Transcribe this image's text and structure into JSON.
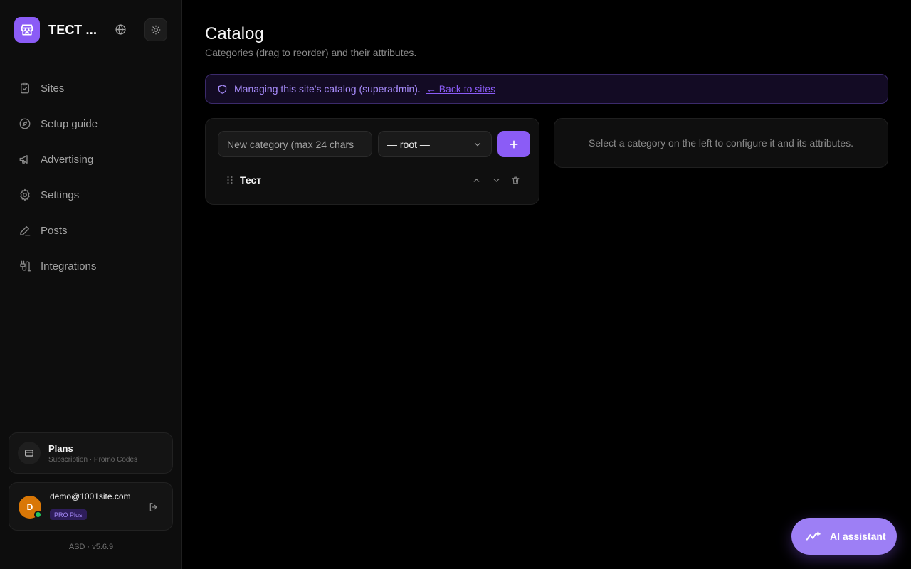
{
  "sidebar": {
    "site_name": "ТЕСТ ...",
    "nav": [
      {
        "label": "Sites",
        "icon": "clipboard-icon"
      },
      {
        "label": "Setup guide",
        "icon": "compass-icon"
      },
      {
        "label": "Advertising",
        "icon": "megaphone-icon"
      },
      {
        "label": "Settings",
        "icon": "gear-icon"
      },
      {
        "label": "Posts",
        "icon": "pencil-icon"
      },
      {
        "label": "Integrations",
        "icon": "plug-icon"
      }
    ],
    "plans": {
      "title": "Plans",
      "subtitle": "Subscription · Promo Codes"
    },
    "user": {
      "initial": "D",
      "email": "demo@1001site.com",
      "plan": "PRO Plus"
    },
    "version": "ASD · v5.6.9"
  },
  "main": {
    "title": "Catalog",
    "subtitle": "Categories (drag to reorder) and their attributes.",
    "banner": {
      "text": "Managing this site's catalog (superadmin).",
      "link": "← Back to sites"
    },
    "category_form": {
      "placeholder": "New category (max 24 chars",
      "parent_value": "— root —"
    },
    "categories": [
      {
        "name": "Тест"
      }
    ],
    "empty_state": "Select a category on the left to configure it and its attributes."
  },
  "ai_assistant": {
    "label": "AI assistant"
  },
  "colors": {
    "accent": "#8b5cf6",
    "background": "#000000",
    "sidebar": "#0d0d0d"
  }
}
